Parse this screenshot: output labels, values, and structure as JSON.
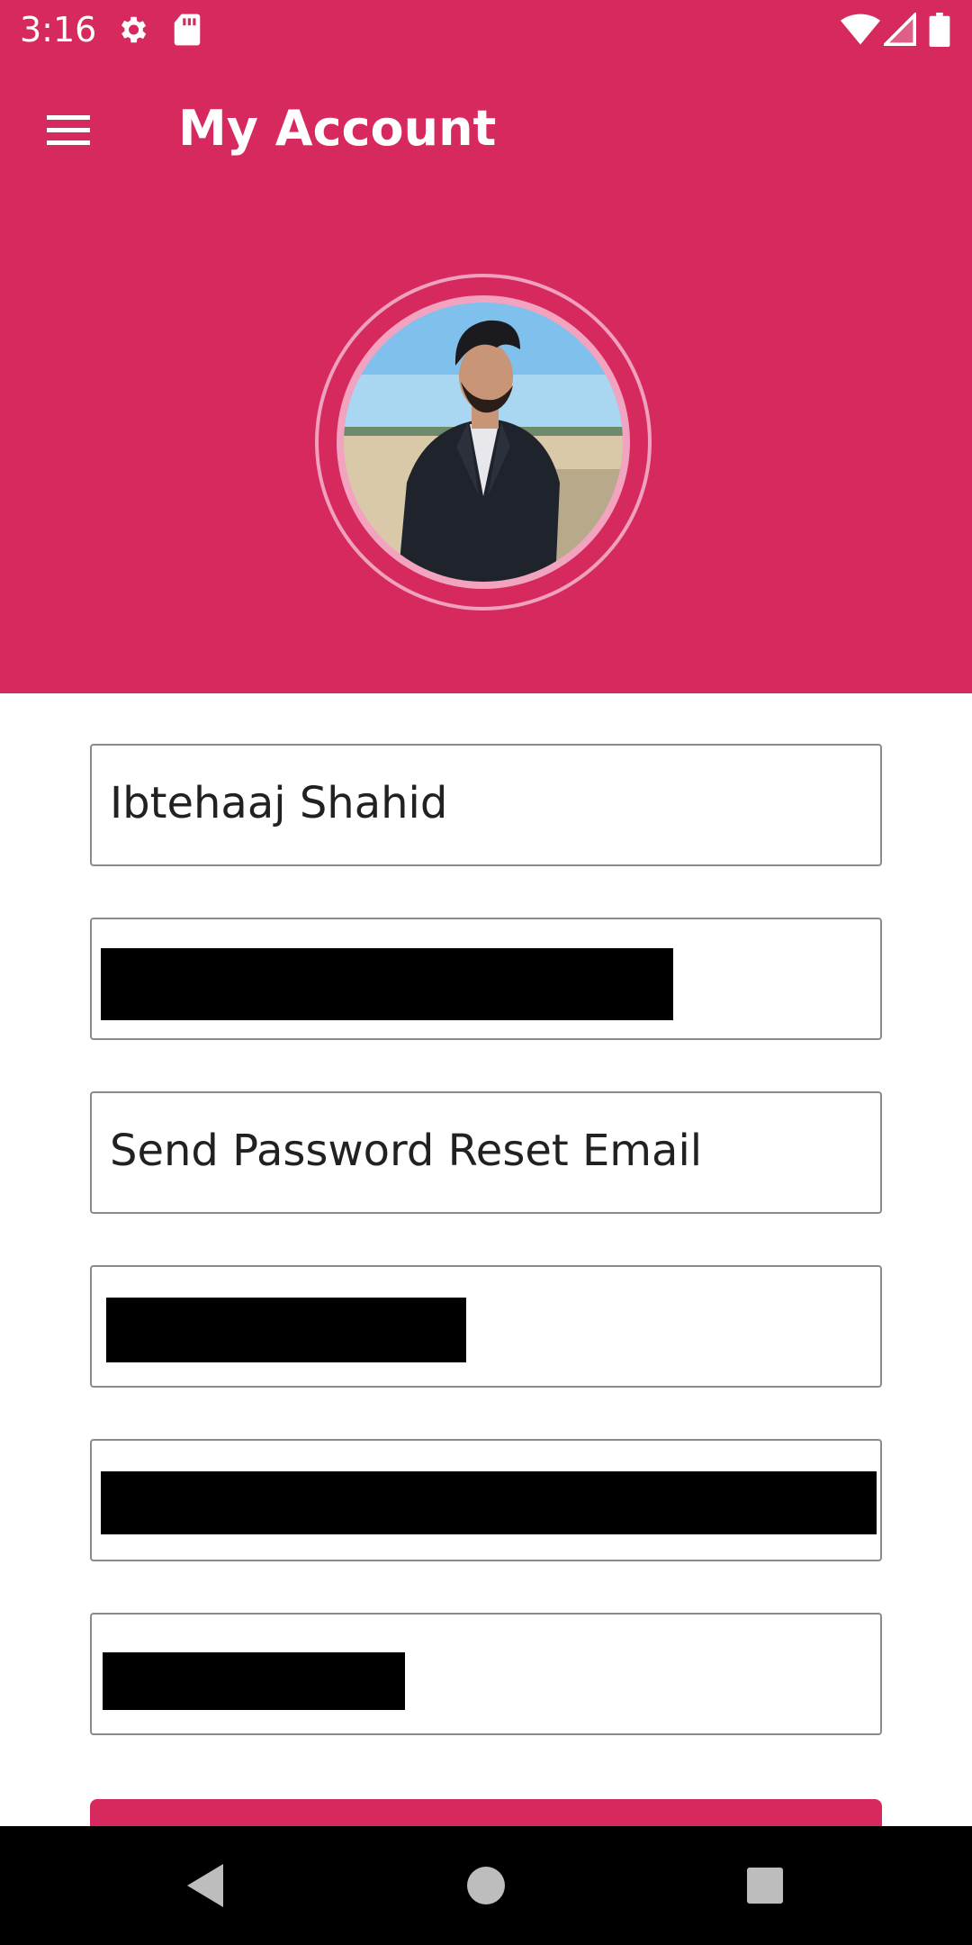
{
  "status_bar": {
    "time": "3:16",
    "icons": [
      "settings-icon",
      "sd-card-icon",
      "wifi-icon",
      "signal-icon",
      "battery-icon"
    ]
  },
  "app_bar": {
    "title": "My Account",
    "menu_icon": "hamburger-menu-icon"
  },
  "profile": {
    "avatar_alt": "profile-photo"
  },
  "form": {
    "name_value": "Ibtehaaj Shahid",
    "email_value": "[redacted]",
    "password_reset_label": "Send Password Reset Email",
    "field4_value": "[redacted]",
    "field5_value": "[redacted]",
    "field6_value": "[redacted]"
  },
  "nav_bar": {
    "back_icon": "back-triangle-icon",
    "home_icon": "home-circle-icon",
    "recents_icon": "recents-square-icon"
  },
  "colors": {
    "primary": "#d62a5e",
    "ring": "#f2a3bf",
    "field_border": "#8a8a8a",
    "text": "#212121"
  }
}
